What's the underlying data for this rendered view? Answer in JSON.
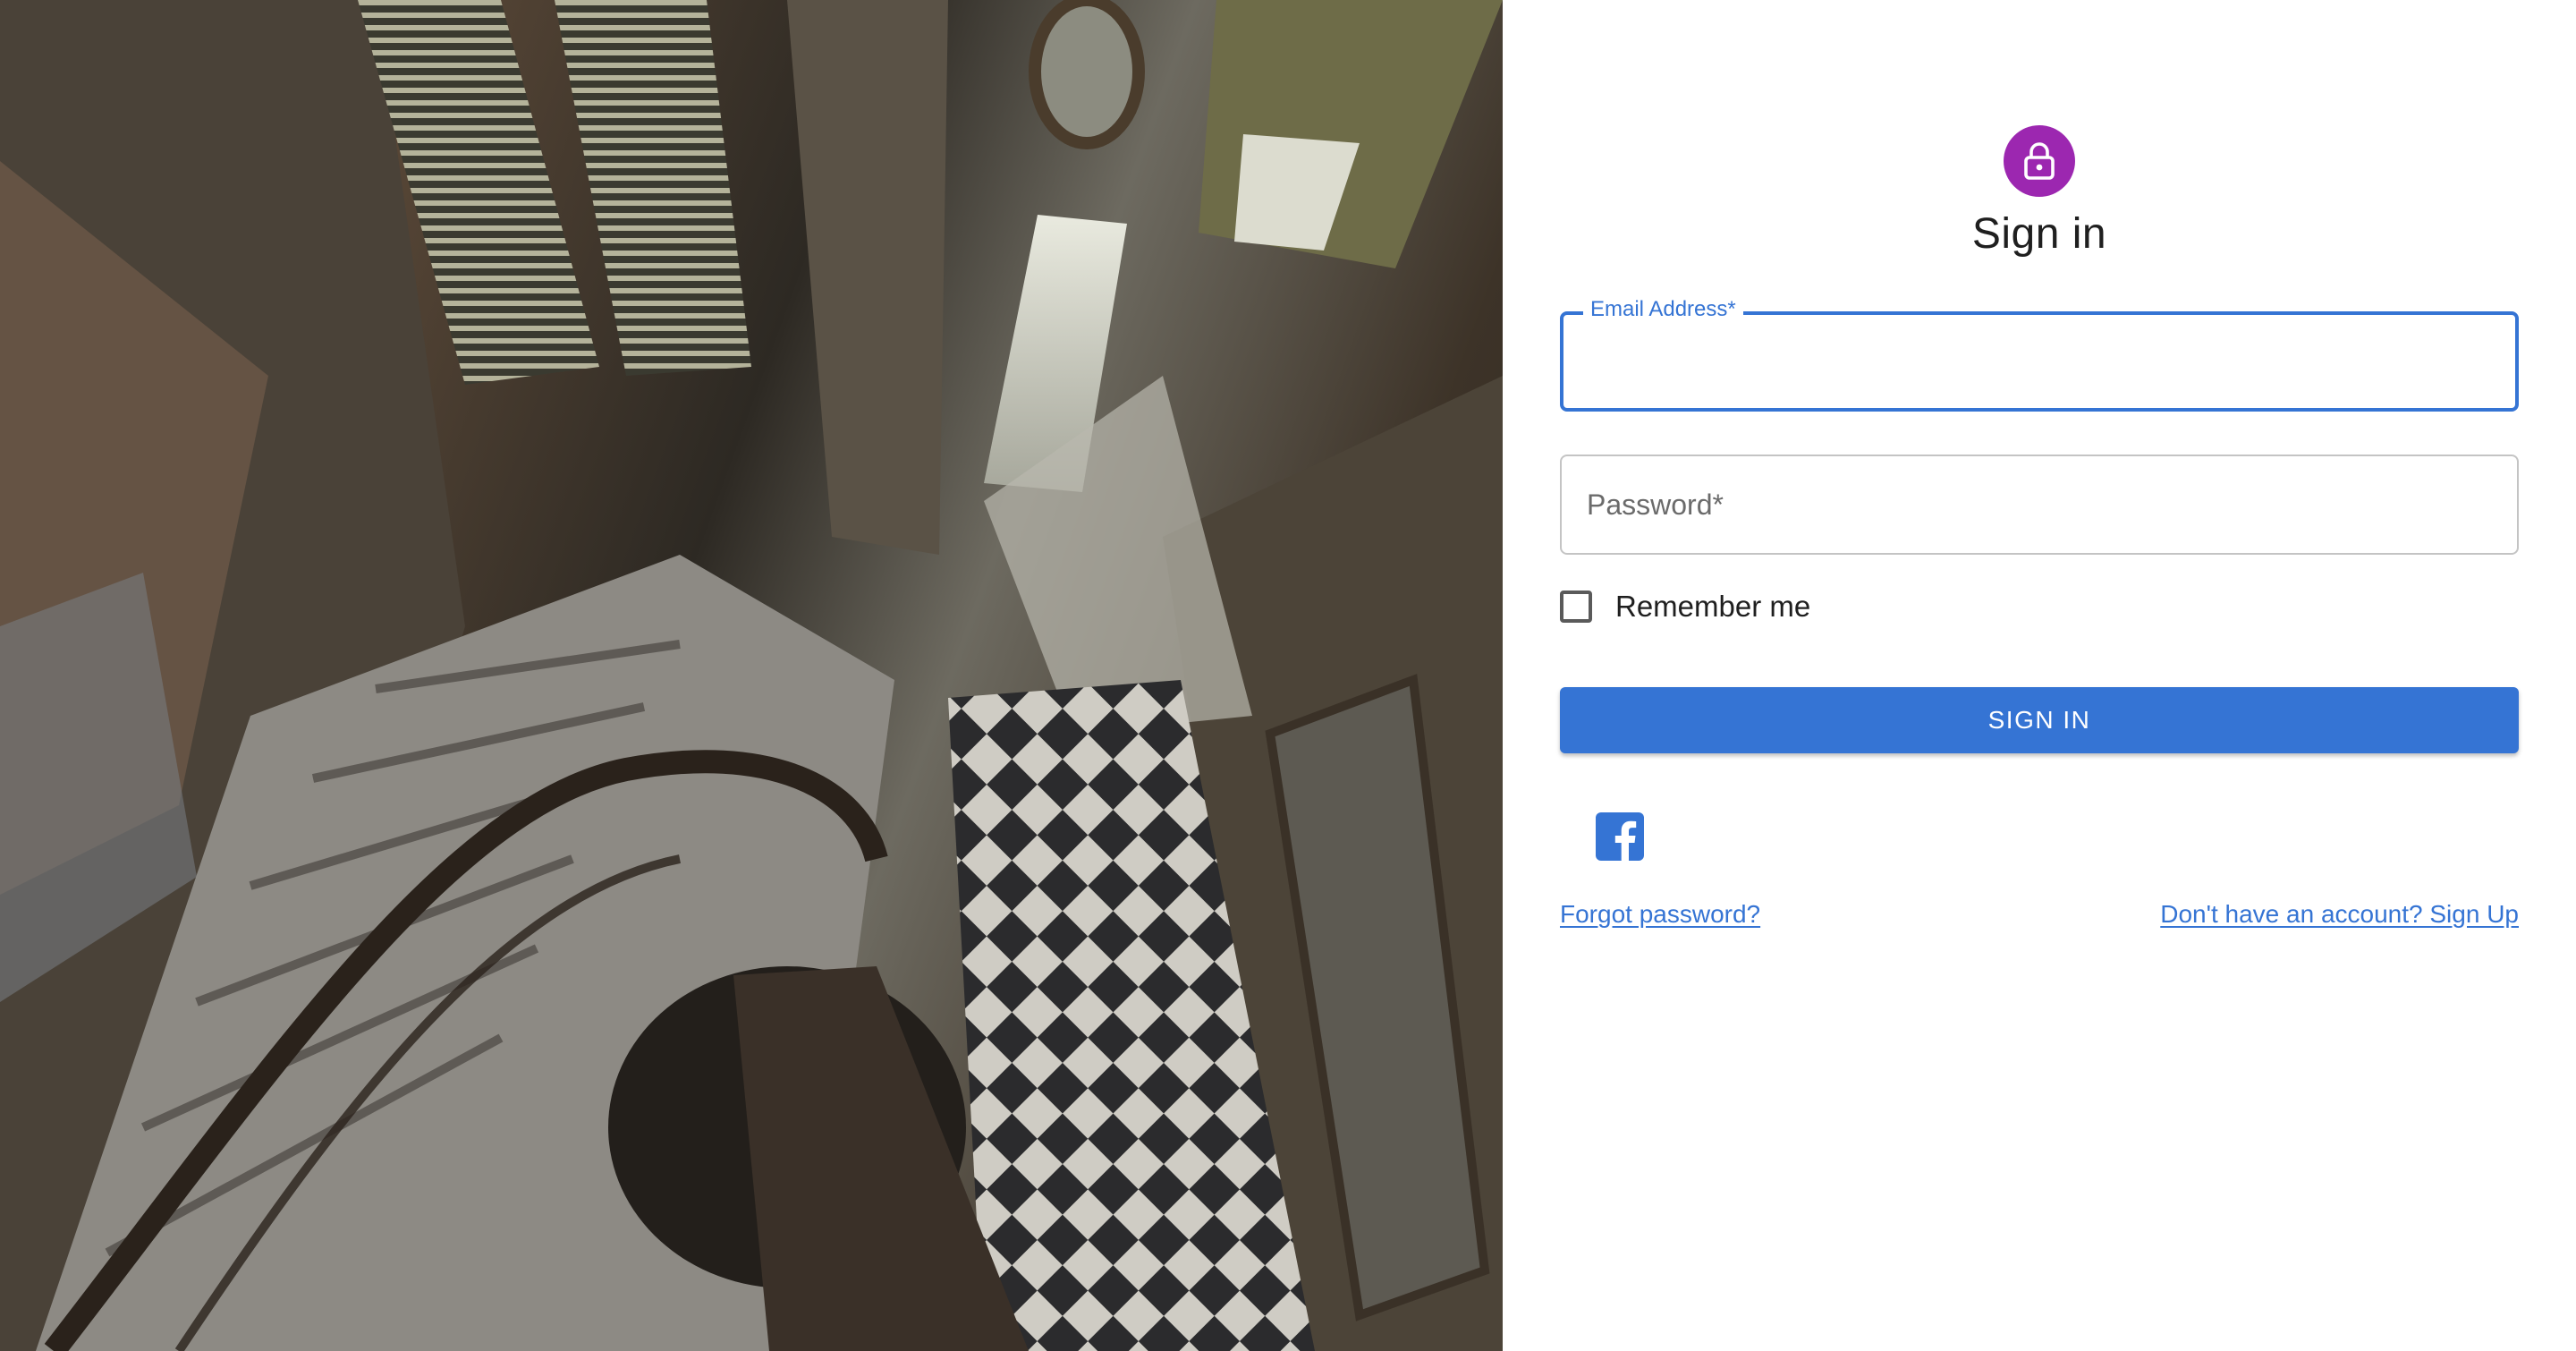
{
  "hero": {
    "image": "abandoned-spiral-staircase-photo"
  },
  "auth": {
    "icon": "lock-icon",
    "accent": "#9c27b0",
    "title": "Sign in",
    "email": {
      "label": "Email Address",
      "required_mark": "*",
      "value": ""
    },
    "password": {
      "label": "Password",
      "required_mark": "*",
      "value": ""
    },
    "remember_label": "Remember me",
    "remember_checked": false,
    "submit_label": "SIGN IN",
    "primary_color": "#3574d4",
    "social": [
      {
        "icon": "facebook-icon",
        "color": "#3574d4"
      }
    ],
    "forgot_link": "Forgot password?",
    "signup_link": "Don't have an account? Sign Up"
  }
}
